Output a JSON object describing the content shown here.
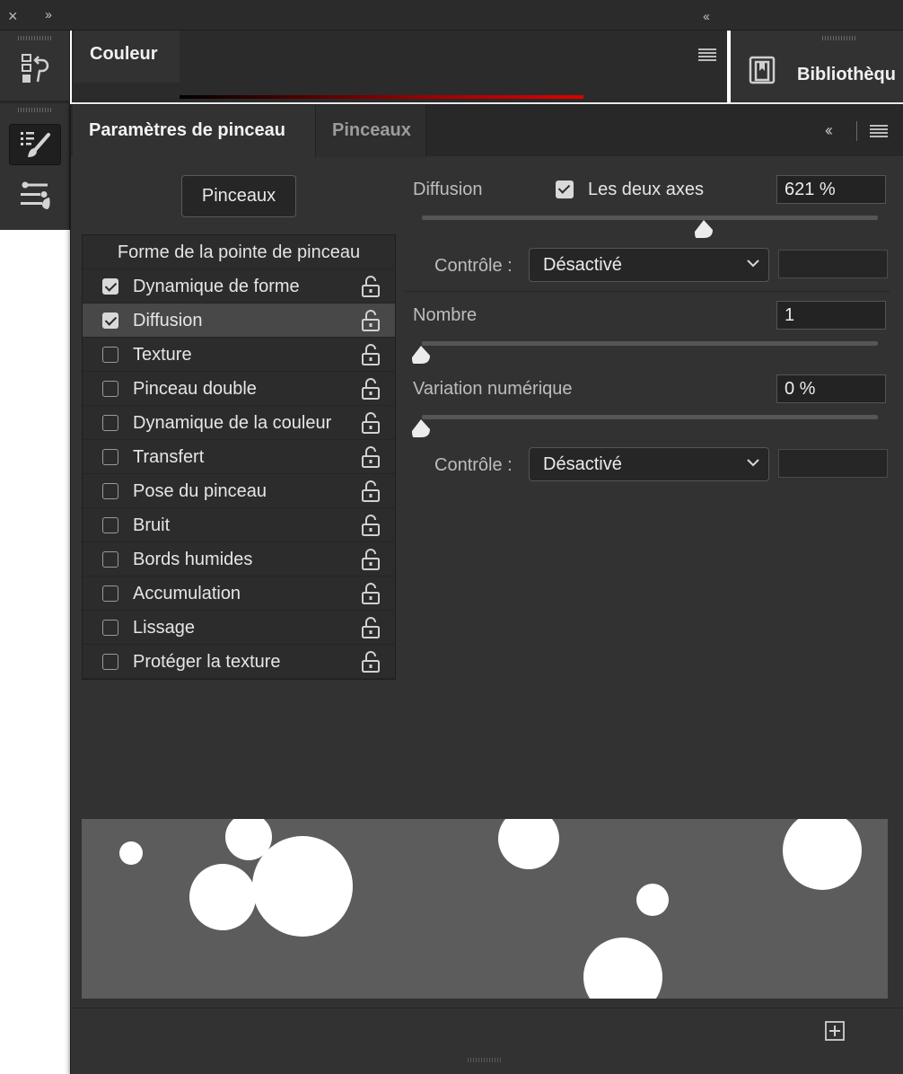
{
  "topbar": {
    "close_glyph": "×",
    "expand_glyph": "››",
    "collapse_glyph": "‹‹"
  },
  "dock": {
    "tools": [
      "history-icon",
      "brush-settings-icon",
      "brush-presets-icon"
    ]
  },
  "couleur_panel": {
    "title": "Couleur",
    "menu_icon": "panel-menu-icon"
  },
  "library_panel": {
    "title": "Bibliothèqu",
    "icon": "libraries-icon"
  },
  "brush_panel": {
    "tabs": [
      {
        "label": "Paramètres de pinceau",
        "active": true
      },
      {
        "label": "Pinceaux",
        "active": false
      }
    ],
    "collapse_glyph": "‹‹",
    "presets_button": "Pinceaux",
    "list_header": "Forme de la pointe de pinceau",
    "items": [
      {
        "label": "Dynamique de forme",
        "checked": true,
        "selected": false
      },
      {
        "label": "Diffusion",
        "checked": true,
        "selected": true
      },
      {
        "label": "Texture",
        "checked": false,
        "selected": false
      },
      {
        "label": "Pinceau double",
        "checked": false,
        "selected": false
      },
      {
        "label": "Dynamique de la couleur",
        "checked": false,
        "selected": false
      },
      {
        "label": "Transfert",
        "checked": false,
        "selected": false
      },
      {
        "label": "Pose du pinceau",
        "checked": false,
        "selected": false
      },
      {
        "label": "Bruit",
        "checked": false,
        "selected": false
      },
      {
        "label": "Bords humides",
        "checked": false,
        "selected": false
      },
      {
        "label": "Accumulation",
        "checked": false,
        "selected": false
      },
      {
        "label": "Lissage",
        "checked": false,
        "selected": false
      },
      {
        "label": "Protéger la texture",
        "checked": false,
        "selected": false
      }
    ],
    "scatter": {
      "label": "Diffusion",
      "both_axes_label": "Les deux axes",
      "both_axes_checked": true,
      "value": "621 %",
      "slider_fraction": 0.62,
      "control_label": "Contrôle :",
      "control_value": "Désactivé"
    },
    "count": {
      "label": "Nombre",
      "value": "1",
      "slider_fraction": 0.0
    },
    "count_jitter": {
      "label": "Variation numérique",
      "value": "0 %",
      "slider_fraction": 0.0,
      "control_label": "Contrôle :",
      "control_value": "Désactivé"
    },
    "new_button_icon": "new-preset-icon"
  }
}
